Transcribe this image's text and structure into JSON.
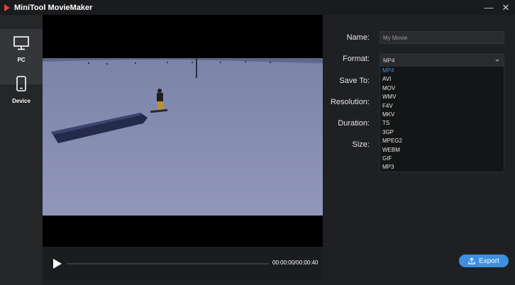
{
  "app": {
    "title": "MiniTool MovieMaker"
  },
  "window": {
    "minimize": "—",
    "close": "✕"
  },
  "sidebar": {
    "items": [
      {
        "label": "PC",
        "icon": "monitor-icon",
        "selected": true
      },
      {
        "label": "Device",
        "icon": "phone-icon",
        "selected": false
      }
    ]
  },
  "player": {
    "timecode": "00:00:00/00:00:40",
    "progress": 0
  },
  "form": {
    "name_label": "Name:",
    "name_value": "My Movie",
    "format_label": "Format:",
    "format_value": "MP4",
    "saveto_label": "Save To:",
    "resolution_label": "Resolution:",
    "duration_label": "Duration:",
    "size_label": "Size:"
  },
  "format_options": [
    "MP4",
    "AVI",
    "MOV",
    "WMV",
    "F4V",
    "MKV",
    "TS",
    "3GP",
    "MPEG2",
    "WEBM",
    "GIF",
    "MP3"
  ],
  "export": {
    "label": "Export"
  },
  "colors": {
    "accent": "#3d8fe0",
    "background": "#1f2023"
  }
}
